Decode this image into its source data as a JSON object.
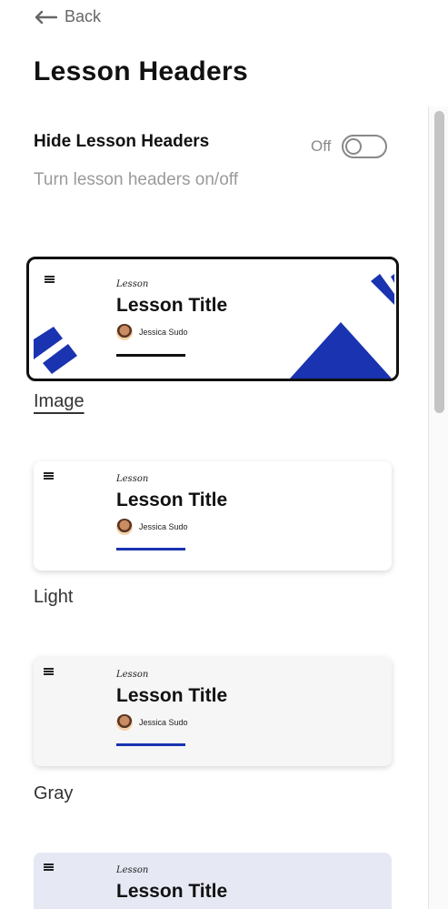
{
  "header": {
    "back_label": "Back",
    "title": "Lesson Headers"
  },
  "setting": {
    "title": "Hide Lesson Headers",
    "description": "Turn lesson headers on/off",
    "toggle_state": "Off"
  },
  "preview": {
    "kicker": "Lesson",
    "title": "Lesson Title",
    "author": "Jessica Sudo"
  },
  "styles": [
    {
      "label": "Image",
      "selected": true
    },
    {
      "label": "Light",
      "selected": false
    },
    {
      "label": "Gray",
      "selected": false
    },
    {
      "label": "",
      "selected": false
    }
  ],
  "colors": {
    "accent": "#1a33b0",
    "muted_text": "#9a9a9a",
    "blue_card_bg": "#e6e8f4",
    "gray_card_bg": "#f6f6f6"
  }
}
